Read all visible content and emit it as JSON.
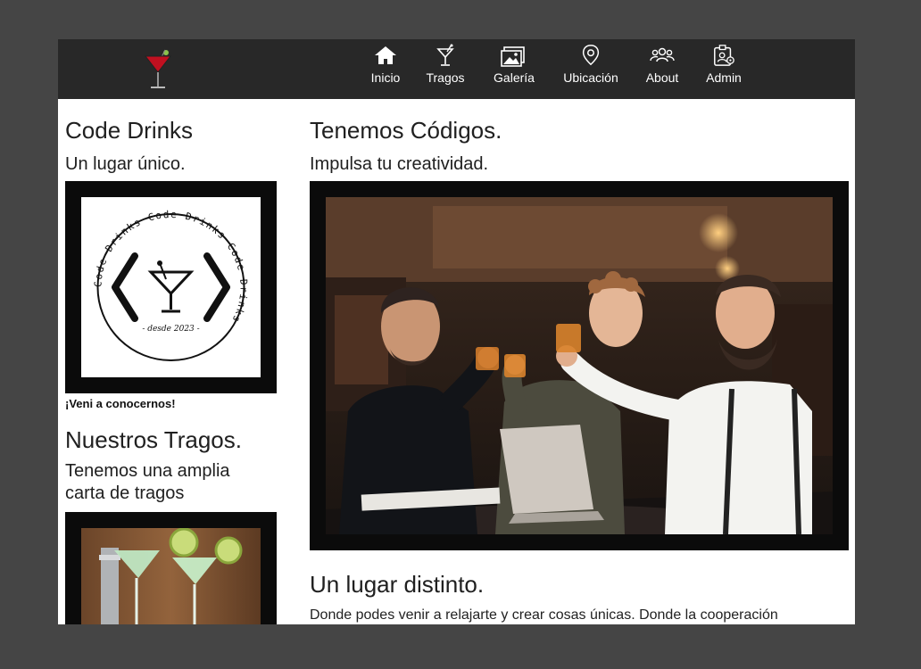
{
  "nav": {
    "items": [
      {
        "label": "Inicio",
        "icon": "home-icon"
      },
      {
        "label": "Tragos",
        "icon": "cocktail-icon"
      },
      {
        "label": "Galería",
        "icon": "gallery-icon"
      },
      {
        "label": "Ubicación",
        "icon": "location-pin-icon"
      },
      {
        "label": "About",
        "icon": "users-icon"
      },
      {
        "label": "Admin",
        "icon": "admin-badge-icon"
      }
    ]
  },
  "sidebar": {
    "brand_title": "Code Drinks",
    "brand_subtitle": "Un lugar único.",
    "logo_ring_text": "Code Drinks   Code Drinks   Code Drinks",
    "logo_since": "- desde 2023 -",
    "caption": "¡Veni a conocernos!",
    "drinks_title": "Nuestros Tragos.",
    "drinks_subtitle_line1": "Tenemos una amplia",
    "drinks_subtitle_line2": "carta de tragos"
  },
  "main": {
    "title": "Tenemos Códigos.",
    "subtitle": "Impulsa tu creatividad.",
    "section2_title": "Un lugar distinto.",
    "section2_text": "Donde podes venir a relajarte y crear cosas únicas. Donde la cooperación"
  },
  "colors": {
    "background": "#454545",
    "navbar": "#282828",
    "frame": "#0b0b0b",
    "accent": "#d6202a"
  }
}
